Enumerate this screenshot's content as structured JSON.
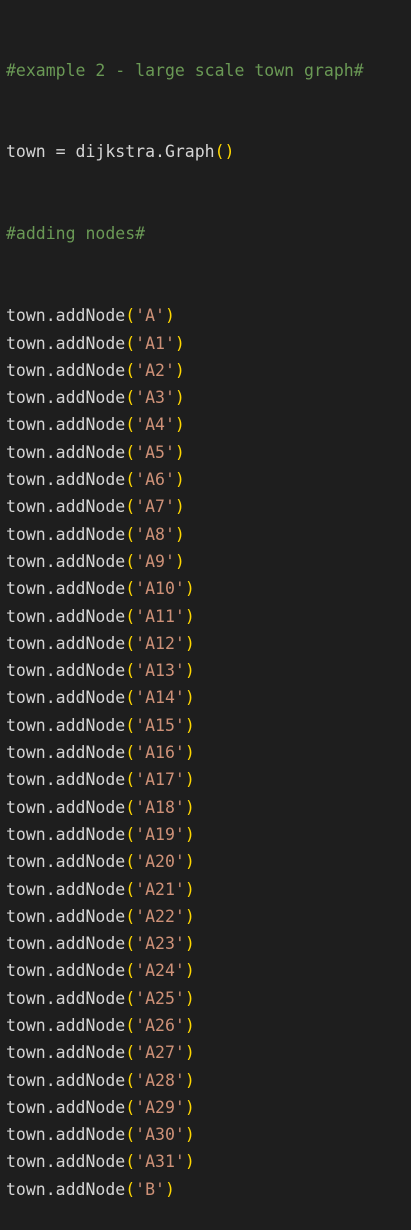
{
  "code": {
    "comment_title": "#example 2 - large scale town graph#",
    "graph_line": {
      "left": "town = dijkstra.Graph",
      "parens": "()"
    },
    "comment_nodes": "#adding nodes#",
    "call_prefix": "town.addNode",
    "node_args": [
      "'A'",
      "'A1'",
      "'A2'",
      "'A3'",
      "'A4'",
      "'A5'",
      "'A6'",
      "'A7'",
      "'A8'",
      "'A9'",
      "'A10'",
      "'A11'",
      "'A12'",
      "'A13'",
      "'A14'",
      "'A15'",
      "'A16'",
      "'A17'",
      "'A18'",
      "'A19'",
      "'A20'",
      "'A21'",
      "'A22'",
      "'A23'",
      "'A24'",
      "'A25'",
      "'A26'",
      "'A27'",
      "'A28'",
      "'A29'",
      "'A30'",
      "'A31'",
      "'B'"
    ],
    "open_paren": "(",
    "close_paren": ")"
  },
  "colors": {
    "background": "#1e1e1e",
    "comment": "#6a9955",
    "identifier": "#d4d4d4",
    "bracket": "#ffd700",
    "string": "#ce9178"
  }
}
